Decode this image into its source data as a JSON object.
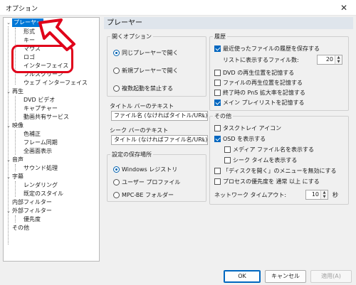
{
  "window": {
    "title": "オプション",
    "close_glyph": "✕"
  },
  "tree": {
    "nodes": [
      {
        "label": "プレーヤー",
        "expanded": true,
        "selected": true
      },
      {
        "label": "形式"
      },
      {
        "label": "キー"
      },
      {
        "label": "マウス"
      },
      {
        "label": "ロゴ"
      },
      {
        "label": "インターフェイス"
      },
      {
        "label": "フルスクリーン"
      },
      {
        "label": "ウェブ インターフェイス"
      },
      {
        "label": "再生",
        "expanded": true
      },
      {
        "label": "DVD ビデオ"
      },
      {
        "label": "キャプチャー"
      },
      {
        "label": "動画共有サービス"
      },
      {
        "label": "映像",
        "expanded": true
      },
      {
        "label": "色補正"
      },
      {
        "label": "フレーム同期"
      },
      {
        "label": "全画面表示"
      },
      {
        "label": "音声",
        "expanded": true
      },
      {
        "label": "サウンド処理"
      },
      {
        "label": "字幕",
        "expanded": true
      },
      {
        "label": "レンダリング"
      },
      {
        "label": "既定のスタイル"
      },
      {
        "label": "内部フィルター"
      },
      {
        "label": "外部フィルター",
        "expanded": true
      },
      {
        "label": "優先度"
      },
      {
        "label": "その他"
      }
    ]
  },
  "page": {
    "header": "プレーヤー",
    "open_options": {
      "legend": "開くオプション",
      "items": [
        {
          "label": "同じプレーヤーで開く",
          "selected": true
        },
        {
          "label": "新規プレーヤーで開く",
          "selected": false
        },
        {
          "label": "複数起動を禁止する",
          "selected": false
        }
      ]
    },
    "titlebar_text": {
      "label": "タイトル バーのテキスト",
      "value": "ファイル名 (なければタイトル/URL)"
    },
    "seekbar_text": {
      "label": "シーク バーのテキスト",
      "value": "タイトル (なければファイル名/URL)"
    },
    "settings_location": {
      "legend": "設定の保存場所",
      "items": [
        {
          "label": "Windows レジストリ",
          "selected": true
        },
        {
          "label": "ユーザー プロファイル",
          "selected": false
        },
        {
          "label": "MPC-BE フォルダー",
          "selected": false
        }
      ]
    },
    "history": {
      "legend": "履歴",
      "save_recent": {
        "label": "最近使ったファイルの履歴を保存する",
        "checked": true
      },
      "list_count_label": "リストに表示するファイル数:",
      "list_count_value": "20",
      "dvd_pos": {
        "label": "DVD の再生位置を記憶する",
        "checked": false
      },
      "file_pos": {
        "label": "ファイルの再生位置を記憶する",
        "checked": false
      },
      "pns_zoom": {
        "label": "終了時の PnS 拡大率を記憶する",
        "checked": false
      },
      "main_playlist": {
        "label": "メイン プレイリストを記憶する",
        "checked": true
      }
    },
    "other": {
      "legend": "その他",
      "tray_icon": {
        "label": "タスクトレイ アイコン",
        "checked": false
      },
      "show_osd": {
        "label": "OSD を表示する",
        "checked": true
      },
      "media_filename": {
        "label": "メディア ファイル名を表示する",
        "checked": false
      },
      "seek_time": {
        "label": "シーク タイムを表示する",
        "checked": false
      },
      "disc_menu": {
        "label": "「ディスクを開く」のメニューを無効にする",
        "checked": false
      },
      "priority": {
        "label": "プロセスの優先度を 通常 以上 にする",
        "checked": false
      },
      "timeout_label": "ネットワーク タイムアウト:",
      "timeout_value": "10",
      "timeout_unit": "秒"
    }
  },
  "buttons": {
    "ok": "OK",
    "cancel": "キャンセル",
    "apply": "適用(A)"
  },
  "icons": {
    "spin_up": "▲",
    "spin_down": "▼",
    "dropdown": "∨",
    "expanded": "⌄"
  },
  "colors": {
    "selection": "#0078d7",
    "annotation": "#e0001a",
    "header_bg": "#dfe5ec"
  }
}
